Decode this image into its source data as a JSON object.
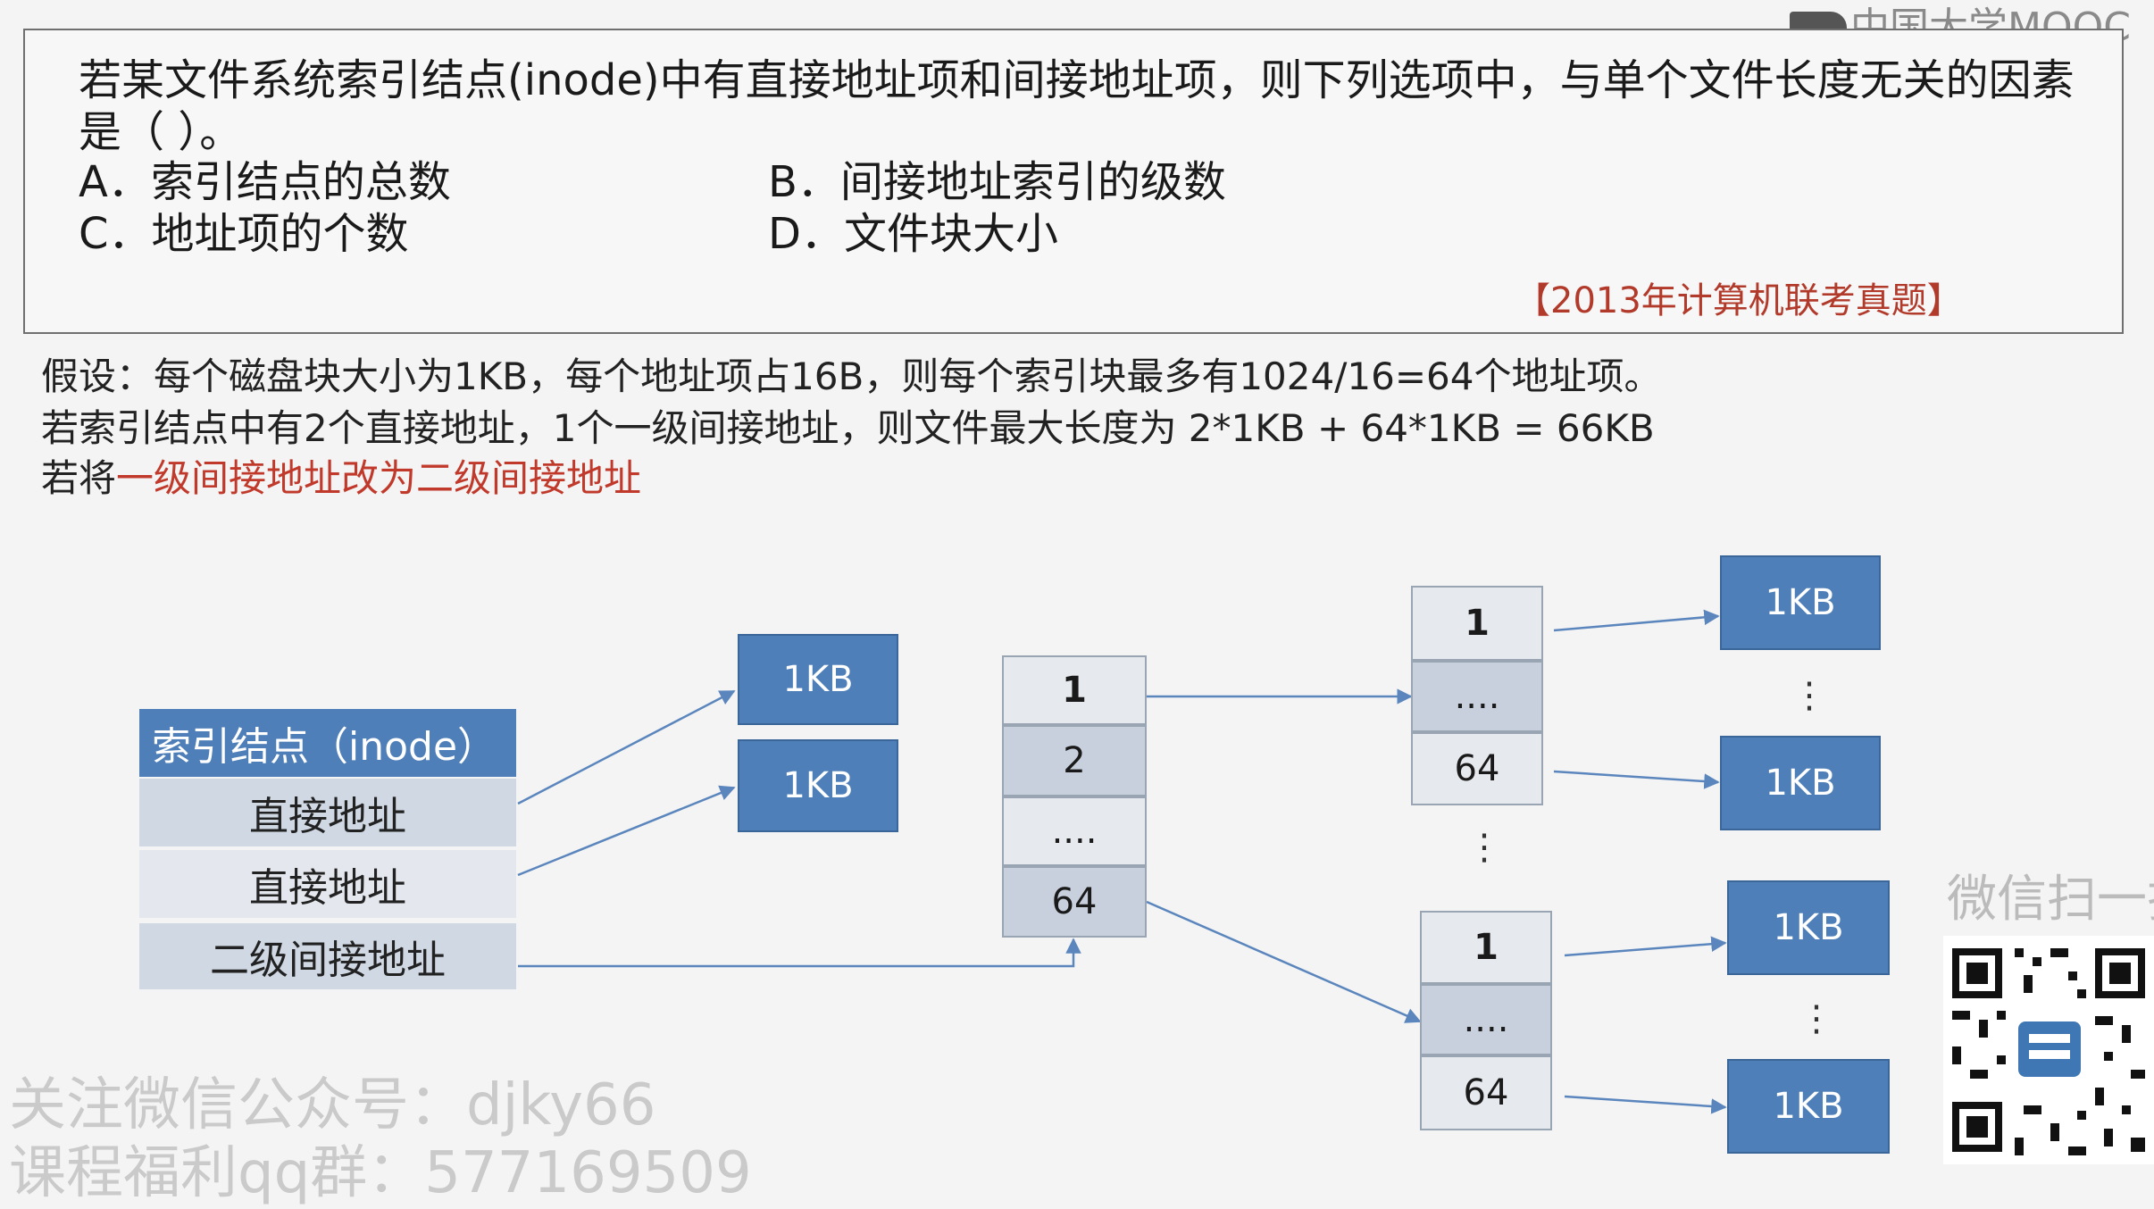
{
  "logo": {
    "text": "中国大学MOOC"
  },
  "question": {
    "line1": "若某文件系统索引结点(inode)中有直接地址项和间接地址项，则下列选项中，与单个文件长度无关的因素",
    "line2": "是（      ）。",
    "options": [
      {
        "label": "A．索引结点的总数"
      },
      {
        "label": "B．间接地址索引的级数"
      },
      {
        "label": "C．地址项的个数"
      },
      {
        "label": "D．文件块大小"
      }
    ],
    "source": "【2013年计算机联考真题】"
  },
  "notes": {
    "line1": "假设：每个磁盘块大小为1KB，每个地址项占16B，则每个索引块最多有1024/16=64个地址项。",
    "line2": "若索引结点中有2个直接地址，1个一级间接地址，则文件最大长度为 2*1KB + 64*1KB = 66KB",
    "line3_prefix": "若将",
    "line3_highlight": "一级间接地址改为二级间接地址"
  },
  "diagram": {
    "inode": {
      "title": "索引结点（inode）",
      "rows": [
        "直接地址",
        "直接地址",
        "二级间接地址"
      ]
    },
    "block_label": "1KB",
    "first_level_index": [
      "1",
      "2",
      "....",
      "64"
    ],
    "second_level_index_top": [
      "1",
      "....",
      "64"
    ],
    "second_level_index_bottom": [
      "1",
      "....",
      "64"
    ],
    "vertical_dots": "⋮"
  },
  "watermark": {
    "line1": "关注微信公众号：djky66",
    "line2": "课程福利qq群：577169509"
  },
  "wechat": {
    "text": "微信扫一扫"
  },
  "colors": {
    "block_blue": "#4f7fb8",
    "arrow": "#5b86bd",
    "source_red": "#b23a2a",
    "highlight_red": "#c0392b"
  }
}
